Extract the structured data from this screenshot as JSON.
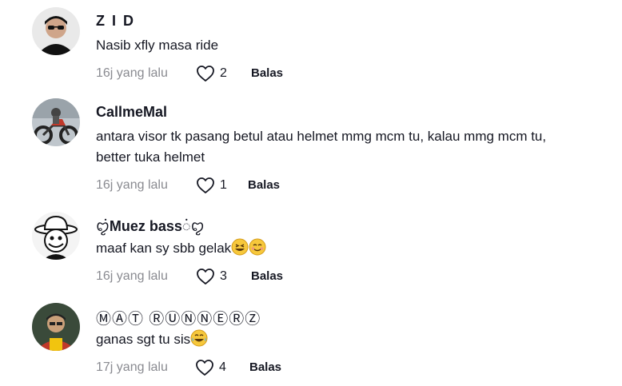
{
  "comments": [
    {
      "username": "Z I D",
      "text": "Nasib xfly masa ride",
      "time": "16j yang lalu",
      "likes": "2",
      "reply_label": "Balas"
    },
    {
      "username": "CallmeMal",
      "text": "antara visor tk pasang betul atau helmet mmg mcm tu, kalau mmg mcm tu, better tuka helmet",
      "time": "16j yang lalu",
      "likes": "1",
      "reply_label": "Balas"
    },
    {
      "username": "Muez bass",
      "text": "maaf kan sy sbb gelak",
      "time": "16j yang lalu",
      "likes": "3",
      "reply_label": "Balas"
    },
    {
      "username": "ⓂⒶⓉ ⓇⓊⓃⓃⒺⓇⓏ",
      "text": "ganas sgt tu sis",
      "time": "17j yang lalu",
      "likes": "4",
      "reply_label": "Balas"
    }
  ],
  "icons": {
    "like": "heart-outline-icon",
    "laugh_emoji": "grinning-squinting-face",
    "smile_emoji": "smiling-face",
    "tears_emoji": "face-with-tears-of-joy"
  }
}
